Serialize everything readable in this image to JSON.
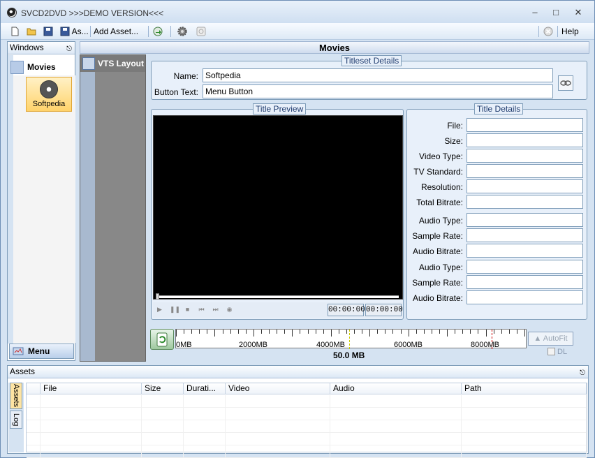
{
  "window": {
    "title": "SVCD2DVD >>>DEMO VERSION<<<"
  },
  "toolbar": {
    "save_as_label": "As...",
    "add_asset_label": "Add Asset...",
    "help_label": "Help"
  },
  "windows_panel": {
    "title": "Windows",
    "movies_label": "Movies",
    "movie_item": "Softpedia",
    "menu_label": "Menu"
  },
  "vts": {
    "title": "VTS Layout"
  },
  "main": {
    "title": "Movies"
  },
  "titleset": {
    "title": "Titleset Details",
    "name_label": "Name:",
    "name_value": "Softpedia",
    "button_label": "Button Text:",
    "button_value": "Menu Button"
  },
  "preview": {
    "title": "Title Preview",
    "time_current": "00:00:00",
    "time_total": "00:00:00"
  },
  "details": {
    "title": "Title Details",
    "fields": [
      "File:",
      "Size:",
      "Video Type:",
      "TV Standard:",
      "Resolution:",
      "Total Bitrate:",
      "Audio Type:",
      "Sample Rate:",
      "Audio Bitrate:",
      "Audio Type:",
      "Sample Rate:",
      "Audio Bitrate:"
    ]
  },
  "sizebar": {
    "labels": [
      "0MB",
      "2000MB",
      "4000MB",
      "6000MB",
      "8000MB"
    ],
    "total": "50.0 MB",
    "autofit_label": "AutoFit",
    "dl_label": "DL"
  },
  "assets": {
    "title": "Assets",
    "tabs": [
      "Assets",
      "Log"
    ],
    "columns": [
      "File",
      "Size",
      "Durati...",
      "Video",
      "Audio",
      "Path"
    ]
  },
  "colors": {
    "accent": "#d5e3f2",
    "border": "#7f9db9",
    "video_bg": "#000000"
  }
}
